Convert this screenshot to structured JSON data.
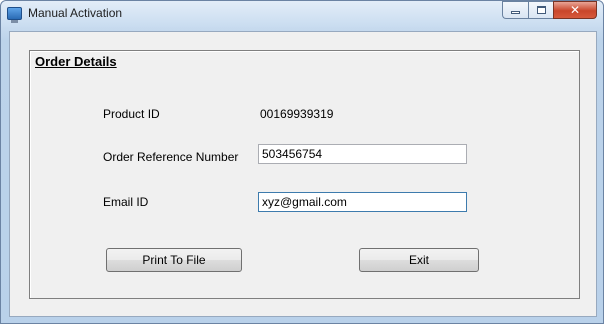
{
  "window": {
    "title": "Manual Activation"
  },
  "group": {
    "title": "Order Details"
  },
  "fields": {
    "product_id": {
      "label": "Product ID",
      "value": "00169939319"
    },
    "order_ref": {
      "label": "Order Reference Number",
      "value": "503456754"
    },
    "email": {
      "label": "Email ID",
      "value": "xyz@gmail.com"
    }
  },
  "buttons": {
    "print": "Print To File",
    "exit": "Exit"
  }
}
